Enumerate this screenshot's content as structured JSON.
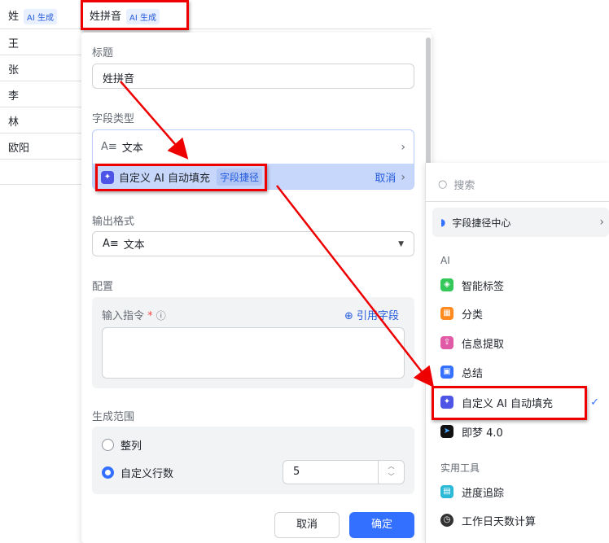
{
  "table": {
    "col1_header": "姓",
    "col2_header": "姓拼音",
    "ai_tag": "AI 生成",
    "rows": [
      "王",
      "张",
      "李",
      "林",
      "欧阳"
    ]
  },
  "panel": {
    "title_label": "标题",
    "title_value": "姓拼音",
    "field_type_label": "字段类型",
    "field_type_text": "文本",
    "shortcut_name": "自定义 AI 自动填充",
    "shortcut_tag": "字段捷径",
    "shortcut_cancel": "取消",
    "output_label": "输出格式",
    "output_value": "文本",
    "config_label": "配置",
    "instruction_label": "输入指令",
    "required_mark": "*",
    "ref_field": "引用字段",
    "instruction_value": "",
    "range_label": "生成范围",
    "range_all": "整列",
    "range_custom": "自定义行数",
    "rows_value": "5",
    "cancel": "取消",
    "confirm": "确定"
  },
  "menu": {
    "search_placeholder": "搜索",
    "center": "字段捷径中心",
    "section_ai": "AI",
    "ai_items": [
      {
        "label": "智能标签",
        "color": "#34c759"
      },
      {
        "label": "分类",
        "color": "#ff8a1f"
      },
      {
        "label": "信息提取",
        "color": "#e05aa6"
      },
      {
        "label": "总结",
        "color": "#3370ff"
      },
      {
        "label": "自定义 AI 自动填充",
        "color": "#4e55e6"
      },
      {
        "label": "即梦 4.0",
        "color": "#111111"
      }
    ],
    "section_tools": "实用工具",
    "tool_items": [
      {
        "label": "进度追踪",
        "color": "#2bb9d6"
      },
      {
        "label": "工作日天数计算",
        "color": "#333333"
      }
    ]
  }
}
